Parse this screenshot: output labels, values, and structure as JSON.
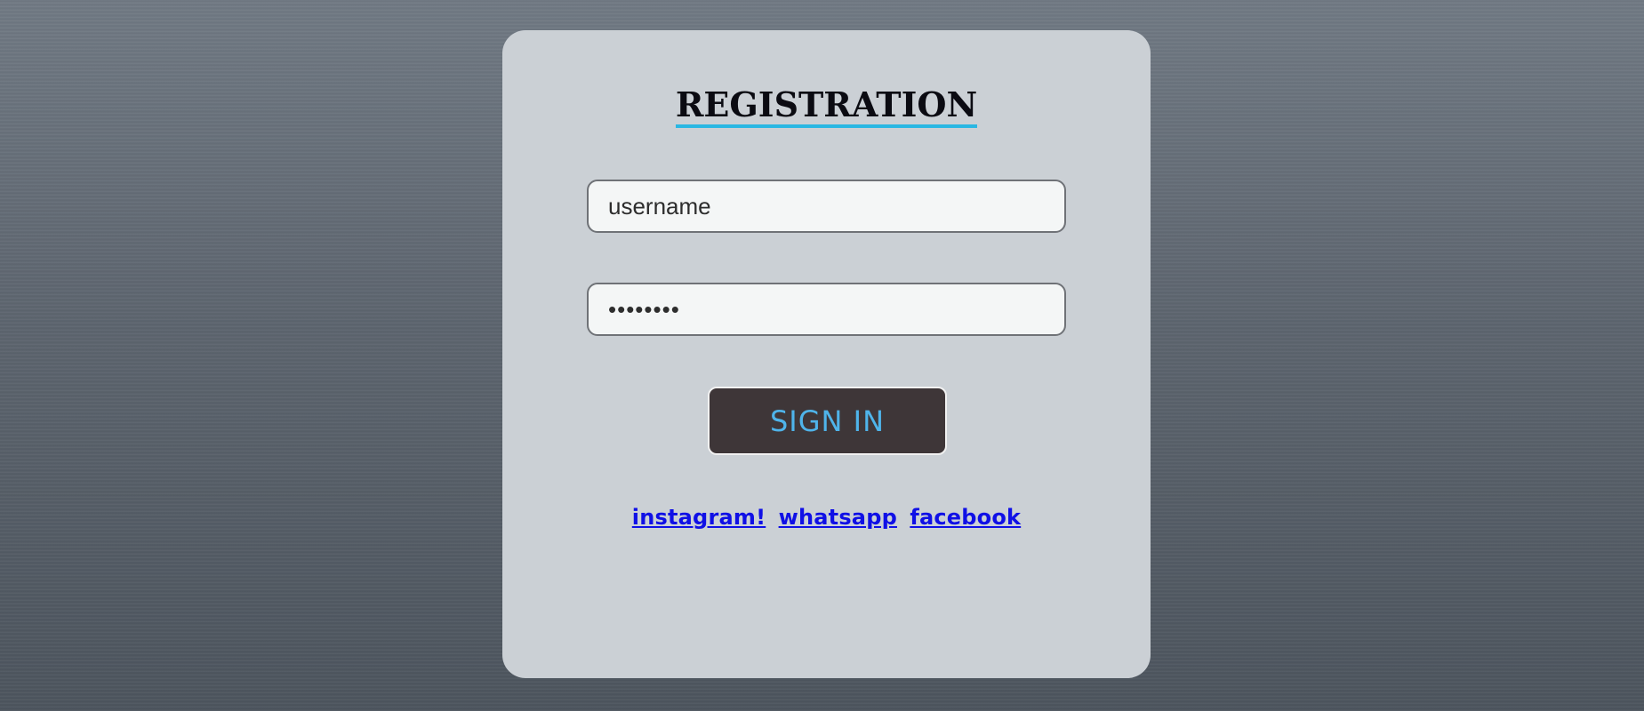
{
  "form": {
    "title": "REGISTRATION",
    "username_placeholder": "username",
    "password_value": "••••••••",
    "sign_in_label": "SIGN IN"
  },
  "links": [
    {
      "label": "instagram!"
    },
    {
      "label": "whatsapp"
    },
    {
      "label": "facebook"
    }
  ],
  "colors": {
    "card_background": "#cbd0d5",
    "title_underline": "#2ab7e3",
    "button_background": "#3e3638",
    "button_text": "#4fb4ea",
    "link_color": "#1010e6"
  }
}
